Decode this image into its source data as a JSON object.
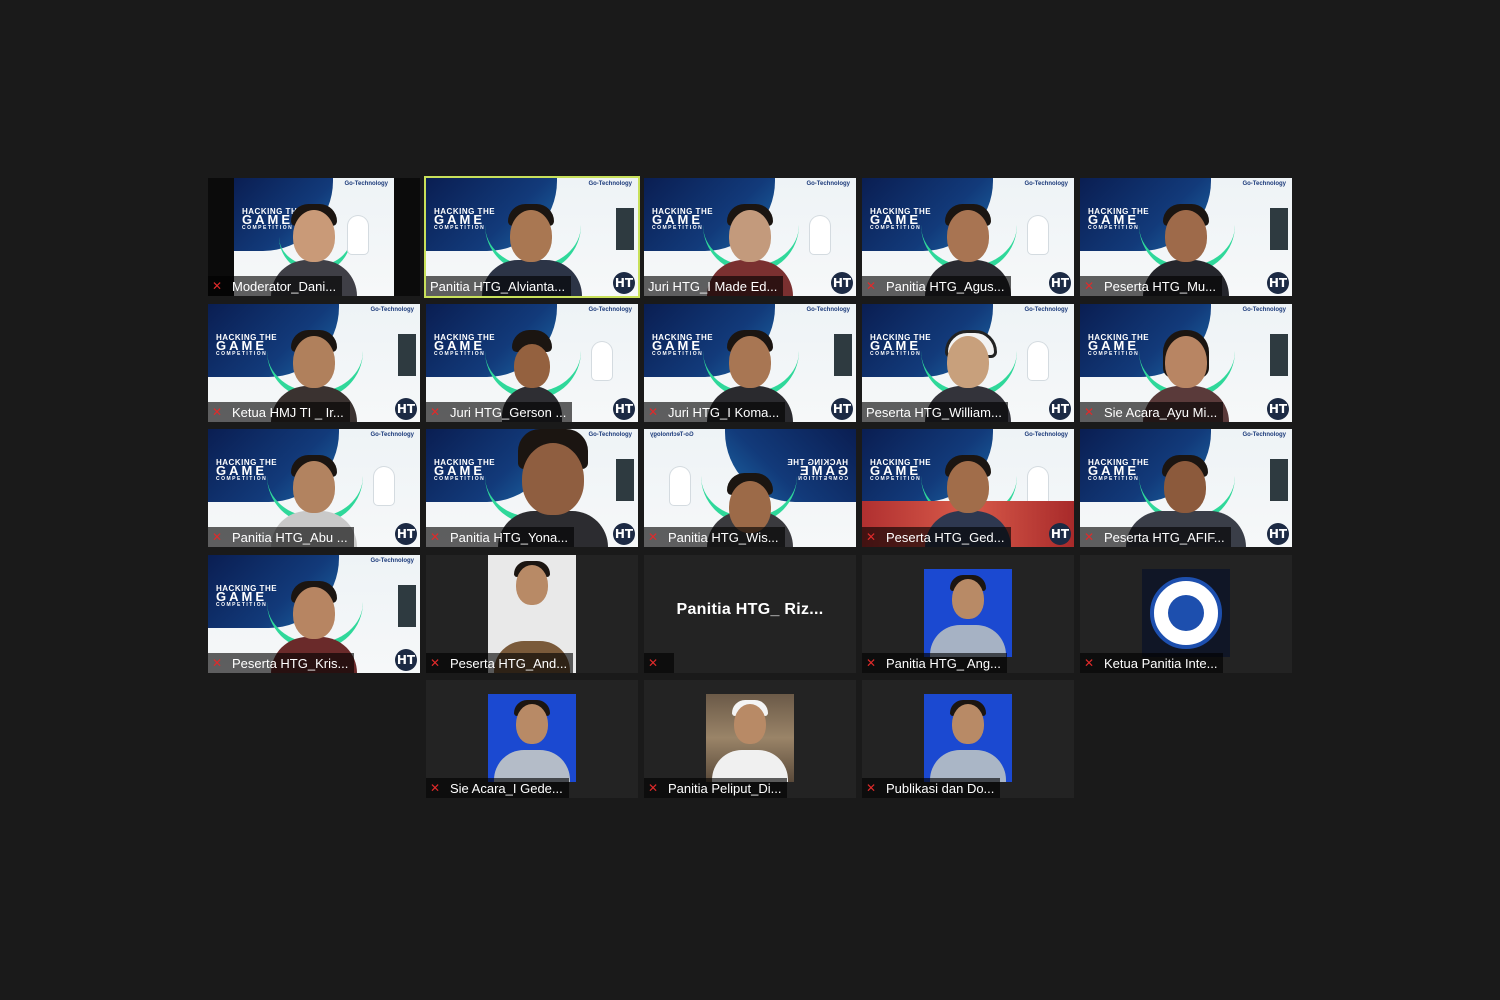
{
  "colors": {
    "background": "#1a1a1a",
    "tile": "#232323",
    "active_speaker_border": "#c8e05a",
    "muted_icon": "#e02a2a"
  },
  "icons": {
    "muted": "microphone-muted-icon",
    "brand_badge": "HT"
  },
  "virtual_background": {
    "brand": "Go-Technology",
    "line1": "HACKING THE",
    "line2": "GAME",
    "line3": "COMPETITION"
  },
  "participants": [
    {
      "name": "Moderator_Dani...",
      "muted": true
    },
    {
      "name": "Panitia HTG_Alvianta...",
      "muted": false,
      "active_speaker": true
    },
    {
      "name": "Juri HTG_I Made Ed...",
      "muted": false
    },
    {
      "name": "Panitia HTG_Agus...",
      "muted": true
    },
    {
      "name": "Peserta HTG_Mu...",
      "muted": true
    },
    {
      "name": "Ketua HMJ TI _ Ir...",
      "muted": true
    },
    {
      "name": "Juri HTG_Gerson ...",
      "muted": true
    },
    {
      "name": "Juri HTG_I Koma...",
      "muted": true
    },
    {
      "name": "Peserta HTG_William...",
      "muted": false
    },
    {
      "name": "Sie Acara_Ayu Mi...",
      "muted": true
    },
    {
      "name": "Panitia HTG_Abu ...",
      "muted": true
    },
    {
      "name": "Panitia HTG_Yona...",
      "muted": true
    },
    {
      "name": "Panitia HTG_Wis...",
      "muted": true
    },
    {
      "name": "Peserta HTG_Ged...",
      "muted": true
    },
    {
      "name": "Peserta HTG_AFIF...",
      "muted": true
    },
    {
      "name": "Peserta HTG_Kris...",
      "muted": true
    },
    {
      "name": "Peserta HTG_And...",
      "muted": true
    },
    {
      "name": "",
      "center_name": "Panitia  HTG_ Riz...",
      "muted": true
    },
    {
      "name": "Panitia HTG_ Ang...",
      "muted": true
    },
    {
      "name": "Ketua Panitia Inte...",
      "muted": true
    },
    {
      "name": "Sie Acara_I Gede...",
      "muted": true
    },
    {
      "name": "Panitia Peliput_Di...",
      "muted": true
    },
    {
      "name": "Publikasi dan Do...",
      "muted": true
    }
  ]
}
